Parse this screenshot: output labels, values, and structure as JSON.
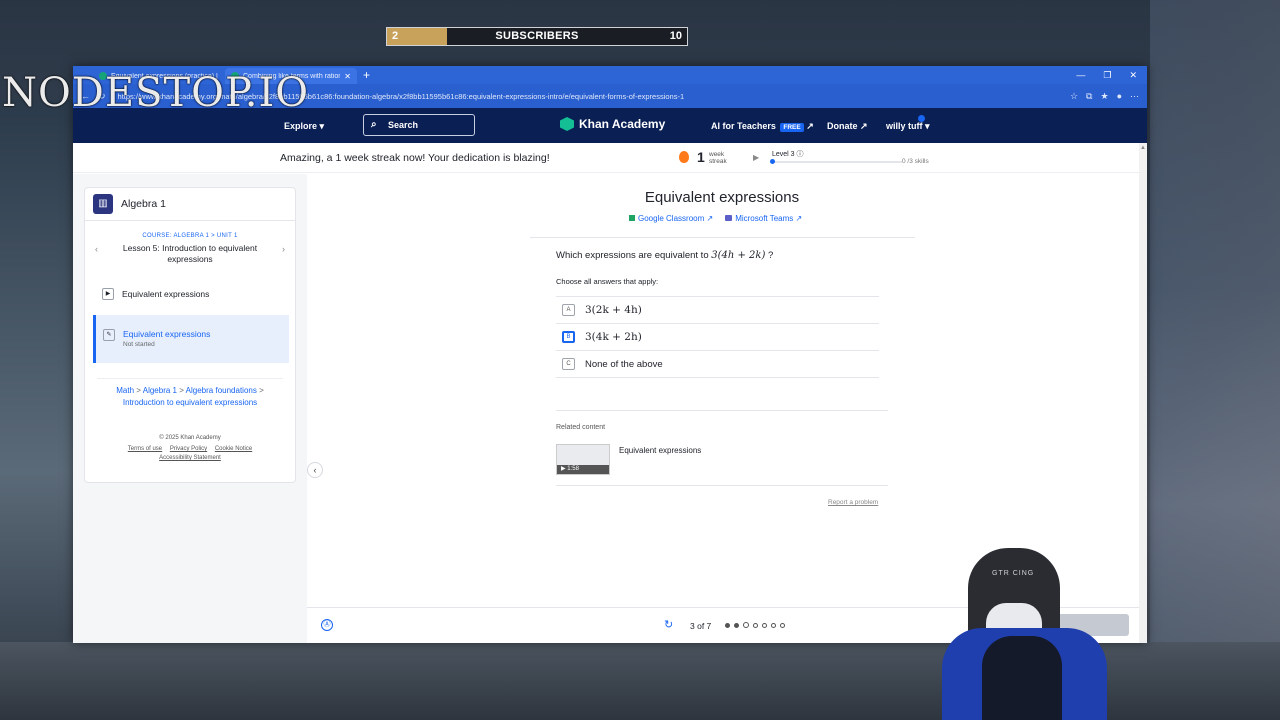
{
  "overlay": {
    "watermark": "NODESTOP.IO",
    "subs_left": "2",
    "subs_label": "SUBSCRIBERS",
    "subs_right": "10",
    "subs_progress": 0.2
  },
  "browser": {
    "tabs": [
      {
        "title": "Equivalent expressions (practice) | Khan Academy"
      },
      {
        "title": "Combining like terms with rational coefficients"
      }
    ],
    "url": "https://www.khanacademy.org/math/algebra/x2f8bb11595b61c86:foundation-algebra/x2f8bb11595b61c86:equivalent-expressions-intro/e/equivalent-forms-of-expressions-1"
  },
  "header": {
    "explore": "Explore",
    "search": "Search",
    "logo": "Khan Academy",
    "ai_teachers": "AI for Teachers",
    "free_badge": "FREE",
    "donate": "Donate",
    "user": "willy tuff"
  },
  "streak": {
    "message": "Amazing, a 1 week streak now! Your dedication is blazing!",
    "count": "1",
    "unit": "week streak",
    "level": "Level 3",
    "skills": "0 /3 skills"
  },
  "sidebar": {
    "course_title": "Algebra 1",
    "course_crumb": "COURSE: ALGEBRA 1 > UNIT 1",
    "lesson_title": "Lesson 5: Introduction to equivalent expressions",
    "items": [
      {
        "label": "Equivalent expressions",
        "sub": ""
      },
      {
        "label": "Equivalent expressions",
        "sub": "Not started"
      }
    ],
    "breadcrumb": [
      "Math",
      "Algebra 1",
      "Algebra foundations",
      "Introduction to equivalent expressions"
    ],
    "copyright": "© 2025 Khan Academy",
    "links": [
      "Terms of use",
      "Privacy Policy",
      "Cookie Notice",
      "Accessibility Statement"
    ]
  },
  "exercise": {
    "title": "Equivalent expressions",
    "google_classroom": "Google Classroom",
    "microsoft_teams": "Microsoft Teams",
    "question_prefix": "Which expressions are equivalent to",
    "question_math": "3(4h + 2k)",
    "question_suffix": "?",
    "instruction": "Choose all answers that apply:",
    "choices": [
      {
        "letter": "A",
        "text": "3(2k + 4h)"
      },
      {
        "letter": "B",
        "text": "3(4k + 2h)"
      },
      {
        "letter": "C",
        "text": "None of the above"
      }
    ],
    "related_label": "Related content",
    "related_duration": "1:58",
    "related_title": "Equivalent expressions",
    "report": "Report a problem"
  },
  "footer": {
    "progress": "3 of 7"
  }
}
